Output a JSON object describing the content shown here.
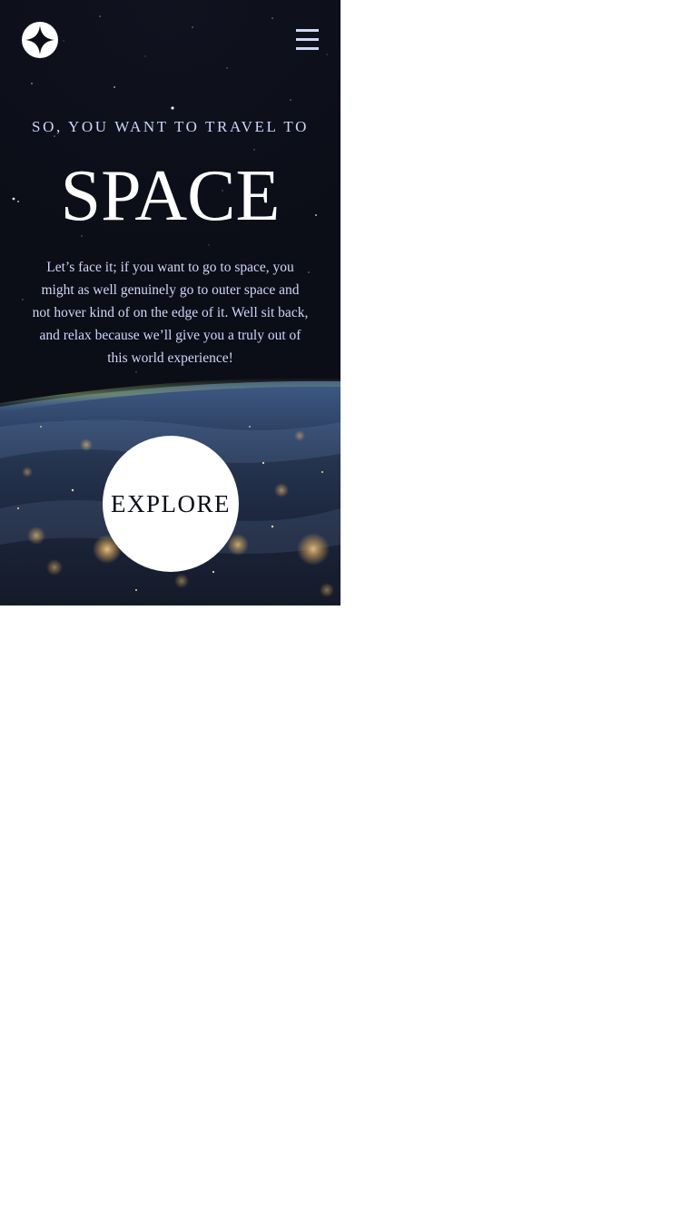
{
  "header": {
    "logo_icon": "star-logo-icon",
    "menu_icon": "hamburger-menu-icon"
  },
  "hero": {
    "subtitle": "SO, YOU WANT TO TRAVEL TO",
    "title": "SPACE",
    "description": "Let’s face it; if you want to go to space, you might as well genuinely go to outer space and not hover kind of on the edge of it. Well sit back, and relax because we’ll give you a truly out of this world experience!",
    "cta_label": "EXPLORE"
  },
  "colors": {
    "background": "#0b0d17",
    "accent": "#d0d6f9",
    "white": "#ffffff"
  }
}
